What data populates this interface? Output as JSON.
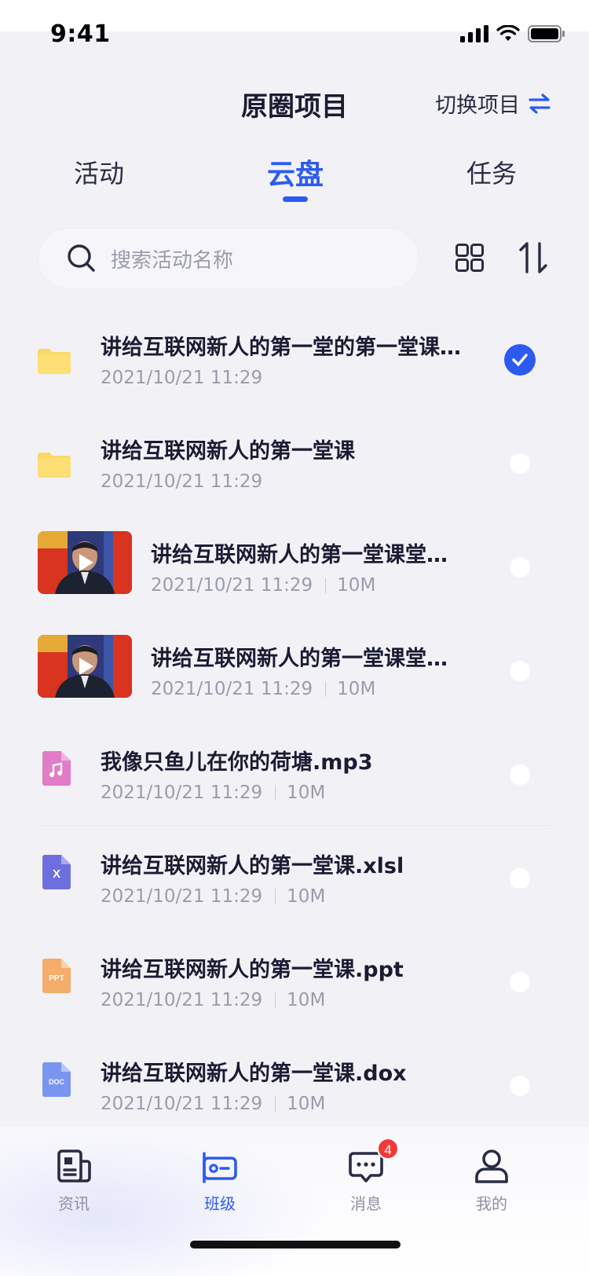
{
  "status_bar": {
    "time": "9:41"
  },
  "header": {
    "title": "原圈项目",
    "switch_label": "切换项目"
  },
  "tabs": [
    {
      "label": "活动",
      "active": false
    },
    {
      "label": "云盘",
      "active": true
    },
    {
      "label": "任务",
      "active": false
    }
  ],
  "search": {
    "placeholder": "搜索活动名称"
  },
  "files": [
    {
      "type": "folder",
      "name": "讲给互联网新人的第一堂的第一堂课…",
      "date": "2021/10/21 11:29",
      "size": "",
      "selected": true
    },
    {
      "type": "folder",
      "name": "讲给互联网新人的第一堂课",
      "date": "2021/10/21 11:29",
      "size": "",
      "selected": false
    },
    {
      "type": "video",
      "name": "讲给互联网新人的第一堂课堂…",
      "date": "2021/10/21 11:29",
      "size": "10M",
      "selected": false
    },
    {
      "type": "video",
      "name": "讲给互联网新人的第一堂课堂…",
      "date": "2021/10/21 11:29",
      "size": "10M",
      "selected": false
    },
    {
      "type": "audio",
      "name": "我像只鱼儿在你的荷塘.mp3",
      "date": "2021/10/21 11:29",
      "size": "10M",
      "selected": false
    },
    {
      "type": "excel",
      "name": "讲给互联网新人的第一堂课.xlsl",
      "date": "2021/10/21 11:29",
      "size": "10M",
      "selected": false
    },
    {
      "type": "ppt",
      "name": "讲给互联网新人的第一堂课.ppt",
      "date": "2021/10/21 11:29",
      "size": "10M",
      "selected": false
    },
    {
      "type": "doc",
      "name": "讲给互联网新人的第一堂课.dox",
      "date": "2021/10/21 11:29",
      "size": "10M",
      "selected": false
    }
  ],
  "file_icon_labels": {
    "excel": "X",
    "ppt": "PPT",
    "doc": "DOC"
  },
  "tabbar": {
    "items": [
      {
        "label": "资讯",
        "active": false
      },
      {
        "label": "班级",
        "active": true
      },
      {
        "label": "消息",
        "active": false,
        "badge": "4"
      },
      {
        "label": "我的",
        "active": false
      }
    ]
  },
  "colors": {
    "accent": "#2d5bf0",
    "folder": "#fcd863",
    "audio": "#e07cc8",
    "excel": "#6e6fde",
    "ppt": "#f4ad6a",
    "doc": "#7a95ef",
    "badge": "#f03a3a"
  }
}
